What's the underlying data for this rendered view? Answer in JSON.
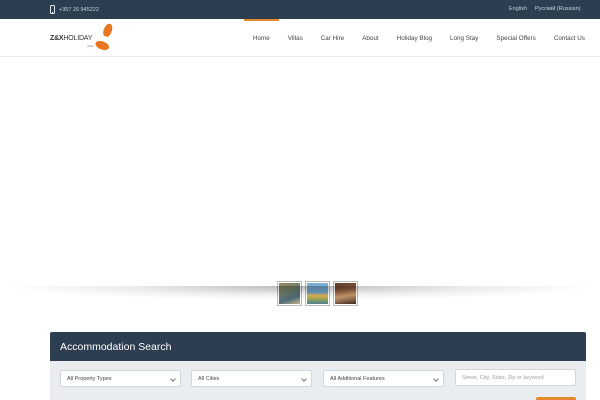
{
  "topbar": {
    "phone": "+357 26 945222",
    "languages": [
      "English",
      "Русский (Russian)"
    ]
  },
  "logo": {
    "text_bold": "Z&X",
    "text": "HOLIDAY",
    "sub": "villas",
    "icon": "orange-flower-logo-icon"
  },
  "nav": {
    "items": [
      "Home",
      "Villas",
      "Car Hire",
      "About",
      "Holiday Blog",
      "Long Stay",
      "Special Offers",
      "Contact Us"
    ],
    "active": "Home"
  },
  "search": {
    "title": "Accommodation Search",
    "property_types": "All Property Types",
    "cities": "All Cities",
    "features": "All Additional Features",
    "keyword_placeholder": "Street, City, State, Zip or keyword"
  },
  "colors": {
    "dark": "#2c3e50",
    "accent": "#e3882f",
    "search_body": "#e9edf0"
  }
}
